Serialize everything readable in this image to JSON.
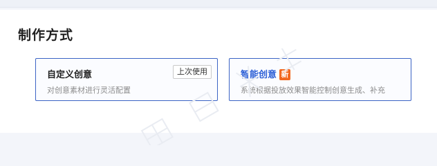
{
  "section": {
    "title": "制作方式"
  },
  "cards": [
    {
      "title": "自定义创意",
      "badge": "上次使用",
      "description": "对创意素材进行灵活配置"
    },
    {
      "title": "智能创意",
      "badge": "新",
      "badge_color": "#f2661d",
      "description": "系统根据投放效果智能控制创意生成、补充"
    }
  ],
  "colors": {
    "accent": "#2c5fd6",
    "border": "#3b63c4"
  }
}
